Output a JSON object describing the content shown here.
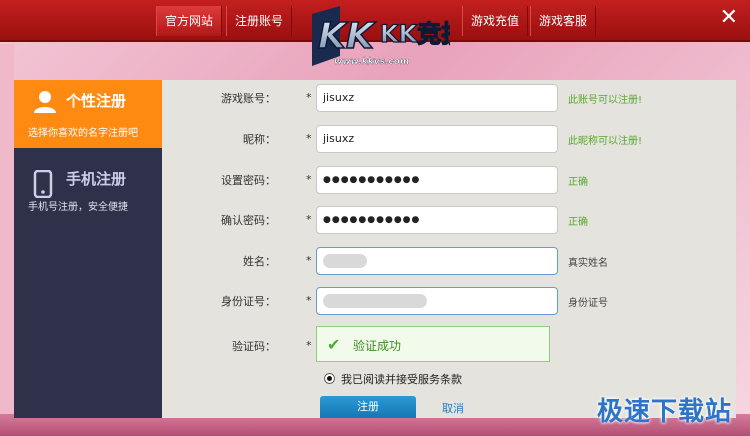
{
  "topnav": {
    "official_site": "官方网站",
    "register_account": "注册账号",
    "recharge": "游戏充值",
    "support": "游戏客服",
    "close_symbol": "✕"
  },
  "logo": {
    "brand": "KK竞技",
    "url": "www.kkvs.com"
  },
  "sidenav": {
    "items": [
      {
        "title": "个性注册",
        "subtitle": "选择你喜欢的名字注册吧",
        "icon": "user-icon"
      },
      {
        "title": "手机注册",
        "subtitle": "手机号注册，安全便捷",
        "icon": "phone-icon"
      }
    ]
  },
  "form": {
    "account": {
      "label": "游戏账号：",
      "value": "jisuxz",
      "hint": "此账号可以注册!"
    },
    "nickname": {
      "label": "昵称：",
      "value": "jisuxz",
      "hint": "此昵称可以注册!"
    },
    "password": {
      "label": "设置密码：",
      "value": "●●●●●●●●●●●",
      "hint": "正确"
    },
    "confirm_password": {
      "label": "确认密码：",
      "value": "●●●●●●●●●●●",
      "hint": "正确"
    },
    "name": {
      "label": "姓名：",
      "hint": "真实姓名"
    },
    "id_number": {
      "label": "身份证号：",
      "hint": "身份证号"
    },
    "captcha": {
      "label": "验证码：",
      "message": "验证成功"
    },
    "required_mark": "*"
  },
  "agree": {
    "text": "我已阅读并接受服务条款"
  },
  "buttons": {
    "register": "注册",
    "cancel": "取消"
  },
  "watermark": "极速下载站",
  "colors": {
    "topbar": "#b51818",
    "sidenav_bg": "#2e3149",
    "active_tab": "#ff8a12",
    "hint_green": "#58a832",
    "button_blue": "#1f88c6"
  }
}
